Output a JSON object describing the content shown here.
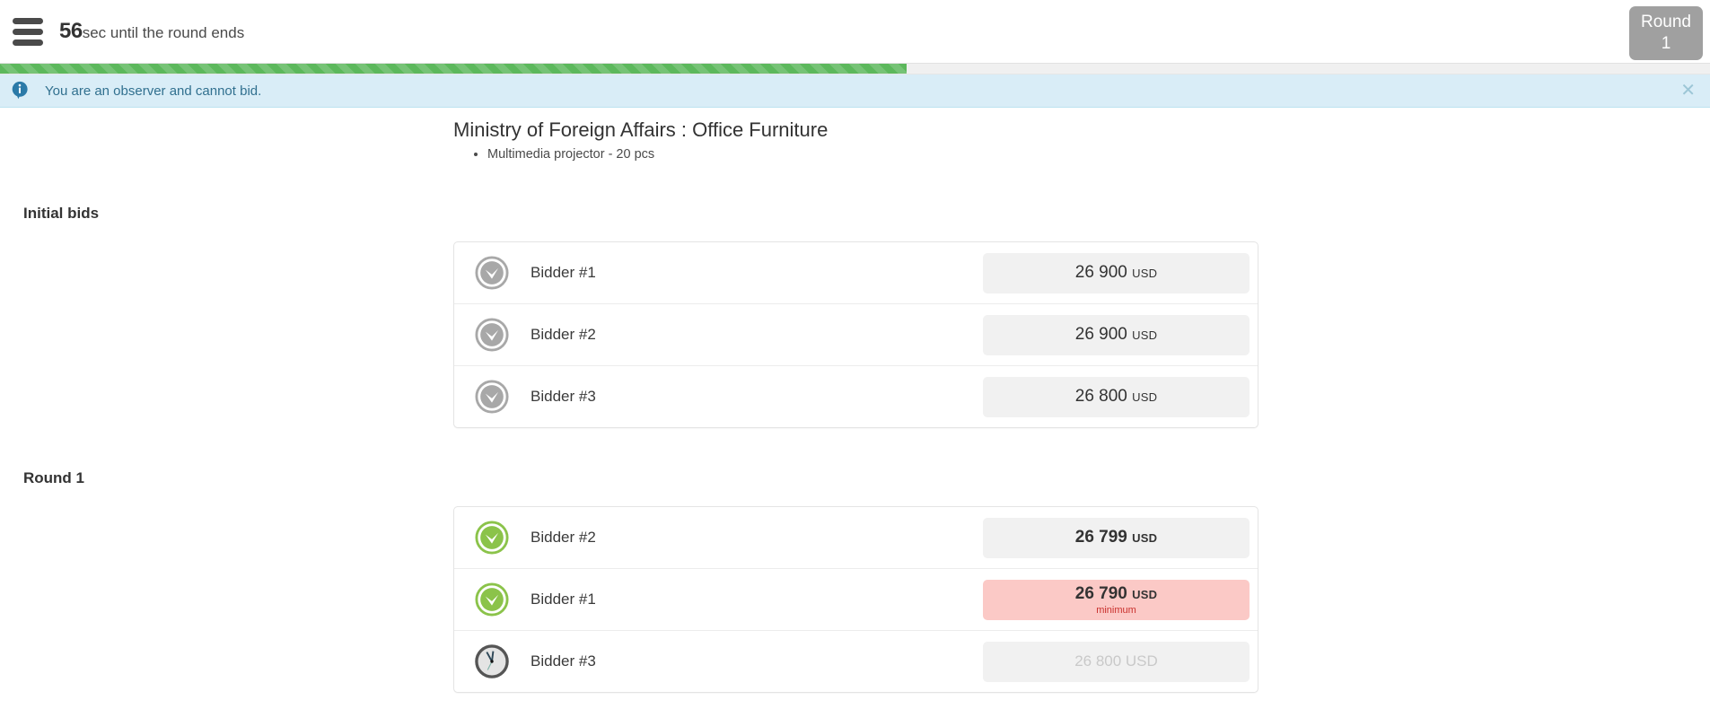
{
  "header": {
    "menu_icon": "hamburger-icon",
    "timer_seconds": "56",
    "timer_label": "sec until the round ends",
    "round_badge": {
      "label": "Round",
      "value": "1"
    }
  },
  "progress": {
    "percent": 53
  },
  "alert": {
    "icon": "info-icon",
    "message": "You are an observer and cannot bid.",
    "close_icon": "close-icon"
  },
  "lot": {
    "title": "Ministry of Foreign Affairs : Office Furniture",
    "items": [
      "Multimedia projector - 20 pcs"
    ]
  },
  "sections": [
    {
      "heading": "Initial bids",
      "rows": [
        {
          "status": "accepted-gray-check-icon",
          "bidder": "Bidder #1",
          "amount": "26 900",
          "currency": "USD",
          "style": "plain",
          "sub": ""
        },
        {
          "status": "accepted-gray-check-icon",
          "bidder": "Bidder #2",
          "amount": "26 900",
          "currency": "USD",
          "style": "plain",
          "sub": ""
        },
        {
          "status": "accepted-gray-check-icon",
          "bidder": "Bidder #3",
          "amount": "26 800",
          "currency": "USD",
          "style": "plain",
          "sub": ""
        }
      ]
    },
    {
      "heading": "Round 1",
      "rows": [
        {
          "status": "accepted-green-check-icon",
          "bidder": "Bidder #2",
          "amount": "26 799",
          "currency": "USD",
          "style": "bold",
          "sub": ""
        },
        {
          "status": "accepted-green-check-icon",
          "bidder": "Bidder #1",
          "amount": "26 790",
          "currency": "USD",
          "style": "minimum",
          "sub": "minimum"
        },
        {
          "status": "waiting-clock-icon",
          "bidder": "Bidder #3",
          "amount": "26 800 USD",
          "currency": "",
          "style": "pending",
          "sub": ""
        }
      ]
    }
  ],
  "colors": {
    "progress_green": "#5cb85c",
    "alert_bg": "#d9edf7",
    "alert_text": "#31708f",
    "minimum_bg": "#fbc9c6",
    "minimum_text": "#c9302c",
    "badge_gray": "#a0a0a0",
    "check_green": "#8bc34a"
  }
}
